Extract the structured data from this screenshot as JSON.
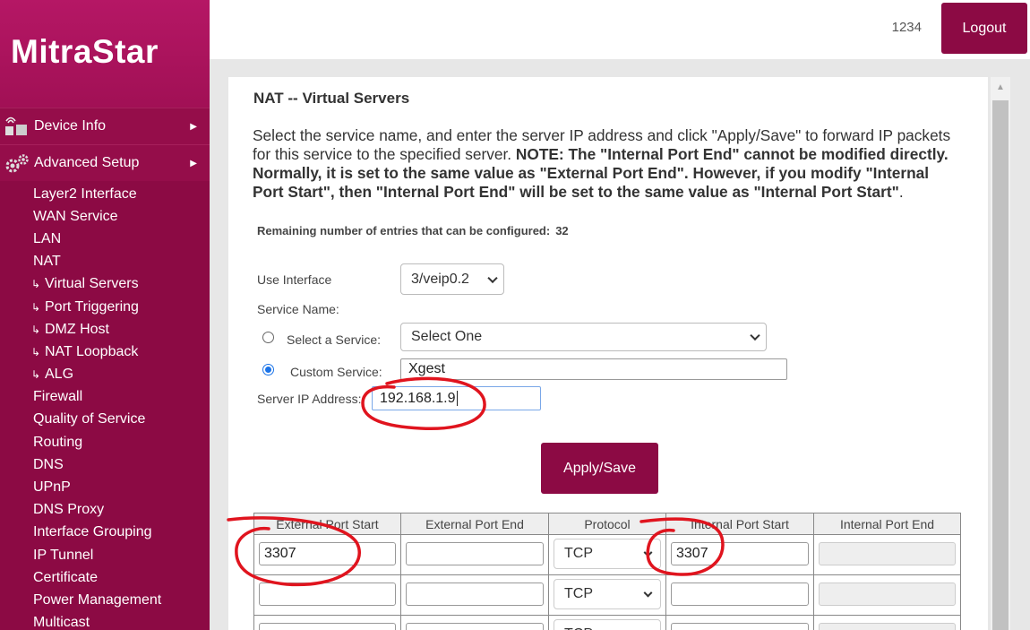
{
  "brand": {
    "logo": "MitraStar"
  },
  "header": {
    "user_id": "1234",
    "logout_label": "Logout"
  },
  "sidebar": {
    "main_items": [
      {
        "label": "Device Info",
        "icon": "device-info-icon"
      },
      {
        "label": "Advanced Setup",
        "icon": "gears-icon"
      }
    ],
    "sub_items": [
      {
        "label": "Layer2 Interface",
        "child": false
      },
      {
        "label": "WAN Service",
        "child": false
      },
      {
        "label": "LAN",
        "child": false
      },
      {
        "label": "NAT",
        "child": false
      },
      {
        "label": "Virtual Servers",
        "child": true
      },
      {
        "label": "Port Triggering",
        "child": true
      },
      {
        "label": "DMZ Host",
        "child": true
      },
      {
        "label": "NAT Loopback",
        "child": true
      },
      {
        "label": "ALG",
        "child": true
      },
      {
        "label": "Firewall",
        "child": false
      },
      {
        "label": "Quality of Service",
        "child": false
      },
      {
        "label": "Routing",
        "child": false
      },
      {
        "label": "DNS",
        "child": false
      },
      {
        "label": "UPnP",
        "child": false
      },
      {
        "label": "DNS Proxy",
        "child": false
      },
      {
        "label": "Interface Grouping",
        "child": false
      },
      {
        "label": "IP Tunnel",
        "child": false
      },
      {
        "label": "Certificate",
        "child": false
      },
      {
        "label": "Power Management",
        "child": false
      },
      {
        "label": "Multicast",
        "child": false
      }
    ]
  },
  "main": {
    "title": "NAT -- Virtual Servers",
    "desc_part1": "Select the service name, and enter the server IP address and click \"Apply/Save\" to forward IP packets for this service to the specified server. ",
    "desc_part2": "NOTE: The \"Internal Port End\" cannot be modified directly. Normally, it is set to the same value as \"External Port End\". However, if you modify \"Internal Port Start\", then \"Internal Port End\" will be set to the same value as \"Internal Port Start\"",
    "desc_part3": ".",
    "remaining_label": "Remaining number of entries that can be configured:",
    "remaining_count": "32",
    "use_interface_label": "Use Interface",
    "use_interface_value": "3/veip0.2",
    "service_name_label": "Service Name:",
    "select_service_label": "Select a Service:",
    "select_service_value": "Select One",
    "custom_service_label": "Custom Service:",
    "custom_service_value": "Xgest",
    "server_ip_label": "Server IP Address:",
    "server_ip_value": "192.168.1.9",
    "apply_label": "Apply/Save",
    "table": {
      "headers": [
        "External Port Start",
        "External Port End",
        "Protocol",
        "Internal Port Start",
        "Internal Port End"
      ],
      "rows": [
        {
          "ext_start": "3307",
          "ext_end": "",
          "protocol": "TCP",
          "int_start": "3307",
          "int_end": ""
        },
        {
          "ext_start": "",
          "ext_end": "",
          "protocol": "TCP",
          "int_start": "",
          "int_end": ""
        },
        {
          "ext_start": "",
          "ext_end": "",
          "protocol": "TCP",
          "int_start": "",
          "int_end": ""
        }
      ]
    }
  },
  "colors": {
    "brand": "#8c0a44",
    "annotation": "#e0141e"
  }
}
